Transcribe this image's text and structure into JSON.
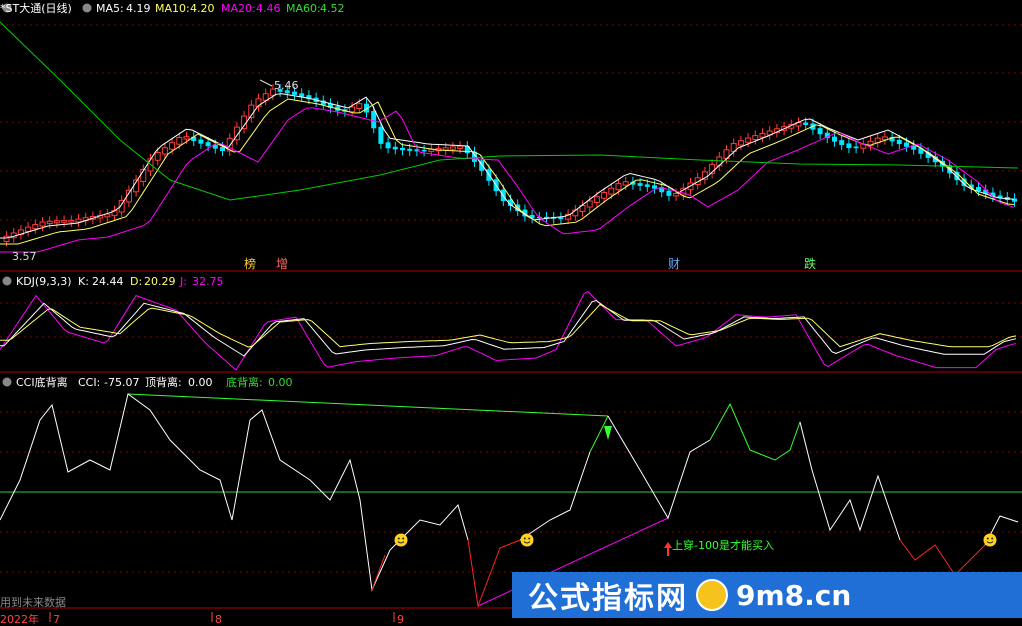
{
  "header": {
    "stock_name": "*ST大通(日线)",
    "ma5_label": "MA5:",
    "ma5_value": "4.19",
    "ma10_label": "MA10:",
    "ma10_value": "4.20",
    "ma20_label": "MA20:",
    "ma20_value": "4.46",
    "ma60_label": "MA60:",
    "ma60_value": "4.52",
    "high_price": "5.46",
    "low_price": "3.57",
    "event_markers": [
      "榜",
      "增",
      "财",
      "跌"
    ]
  },
  "kdj": {
    "title": "KDJ(9,3,3)",
    "k_label": "K:",
    "k_value": "24.44",
    "d_label": "D:",
    "d_value": "20.29",
    "j_label": "J:",
    "j_value": "32.75"
  },
  "cci": {
    "title": "CCI底背离",
    "cci_label": "CCI:",
    "cci_value": "-75.07",
    "top_label": "顶背离:",
    "top_value": "0.00",
    "bottom_label": "底背离:",
    "bottom_value": "0.00",
    "annotation": "上穿-100是才能买入",
    "future_note": "用到未来数据"
  },
  "axis": {
    "year_label": "2022年",
    "months": [
      "7",
      "8",
      "9"
    ]
  },
  "watermark": {
    "text": "公式指标网",
    "site": "9m8.cn"
  },
  "colors": {
    "up": "#ff3b3b",
    "down": "#00e5ff",
    "ma5": "#ffffff",
    "ma10": "#ffff66",
    "ma20": "#ff00ff",
    "ma60": "#00cc00",
    "grid": "#8b0000"
  }
}
